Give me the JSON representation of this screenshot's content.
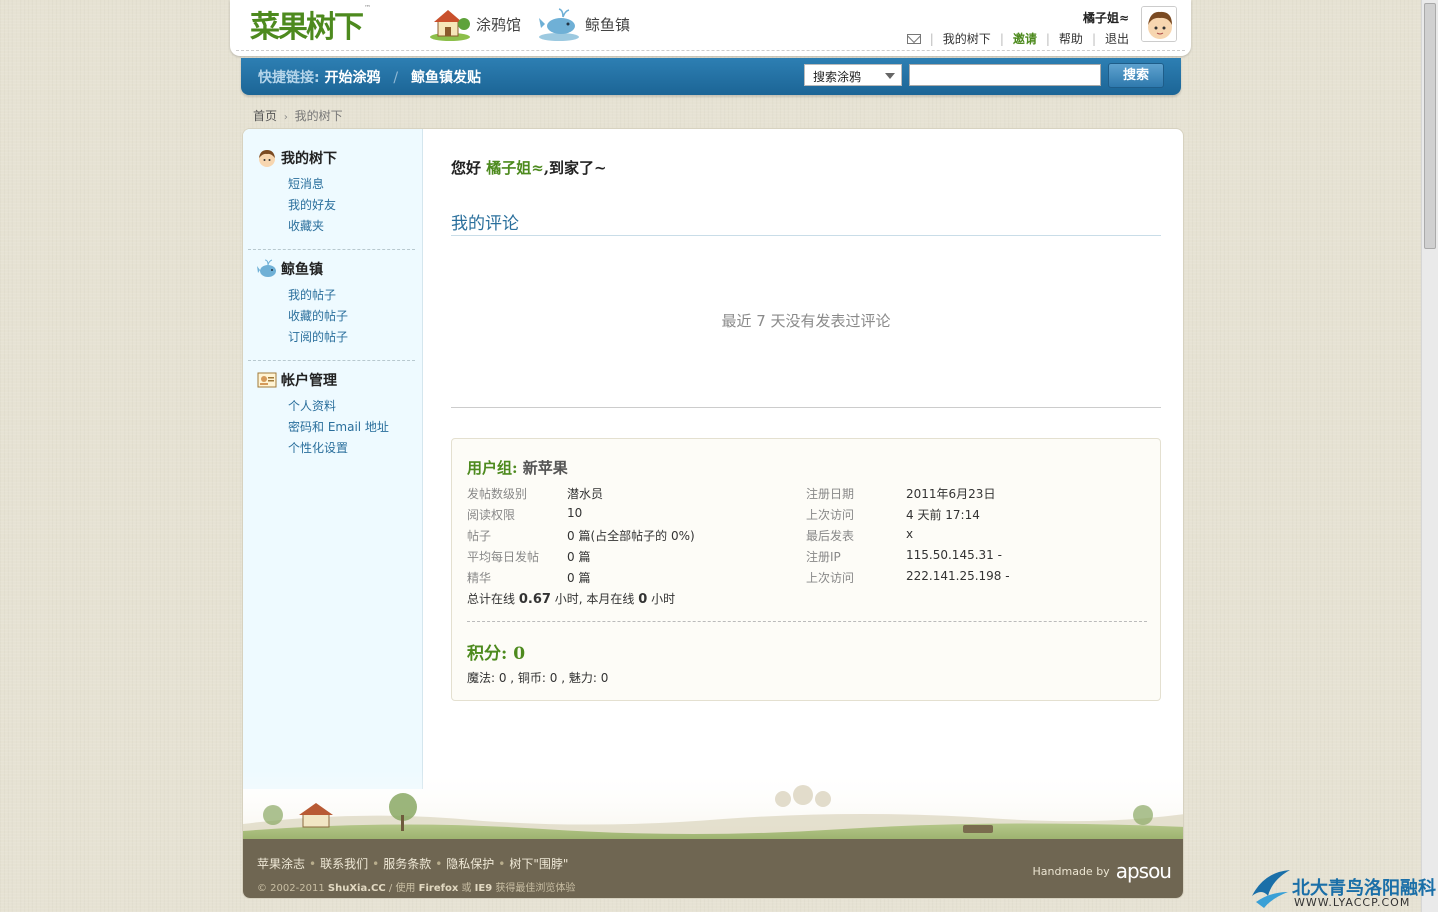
{
  "header": {
    "logo": "菜果树下",
    "logo_tm": "™",
    "nav": [
      {
        "label": "涂鸦馆"
      },
      {
        "label": "鲸鱼镇"
      }
    ],
    "username": "橘子姐≈",
    "links": {
      "mytree": "我的树下",
      "invite": "邀请",
      "help": "帮助",
      "logout": "退出"
    },
    "sep": "|"
  },
  "quickbar": {
    "prefix": "快捷链接:",
    "link1": "开始涂鸦",
    "slash": "/",
    "link2": "鲸鱼镇发贴",
    "select_value": "搜索涂鸦",
    "search_value": "",
    "search_button": "搜索"
  },
  "breadcrumb": {
    "home": "首页",
    "arrow": "›",
    "current": "我的树下"
  },
  "sidebar": {
    "sections": [
      {
        "title": "我的树下",
        "items": [
          "短消息",
          "我的好友",
          "收藏夹"
        ]
      },
      {
        "title": "鲸鱼镇",
        "items": [
          "我的帖子",
          "收藏的帖子",
          "订阅的帖子"
        ]
      },
      {
        "title": "帐户管理",
        "items": [
          "个人资料",
          "密码和 Email 地址",
          "个性化设置"
        ]
      }
    ]
  },
  "main": {
    "greeting_prefix": "您好",
    "greeting_name": "橘子姐≈",
    "greeting_suffix": ",到家了~",
    "section_title": "我的评论",
    "empty_message": "最近 7 天没有发表过评论",
    "usergroup_label": "用户组:",
    "usergroup_value": "新苹果",
    "stats_left": [
      {
        "k": "发帖数级别",
        "v": "潜水员"
      },
      {
        "k": "阅读权限",
        "v": "10"
      },
      {
        "k": "帖子",
        "v": "0 篇(占全部帖子的 0%)"
      },
      {
        "k": "平均每日发帖",
        "v": "0 篇"
      },
      {
        "k": "精华",
        "v": "0 篇"
      }
    ],
    "stats_right": [
      {
        "k": "注册日期",
        "v": "2011年6月23日"
      },
      {
        "k": "上次访问",
        "v": "4 天前 17:14"
      },
      {
        "k": "最后发表",
        "v": "x"
      },
      {
        "k": "注册IP",
        "v": "115.50.145.31 -"
      },
      {
        "k": "上次访问",
        "v": "222.141.25.198 -"
      }
    ],
    "online_a": "总计在线",
    "online_hours": "0.67",
    "online_b": "小时, 本月在线",
    "online_month": "0",
    "online_c": "小时",
    "score_label": "积分: 0",
    "coins": "魔法: 0 , 铜币: 0 , 魅力: 0"
  },
  "footer": {
    "links": [
      "苹果涂志",
      "联系我们",
      "服务条款",
      "隐私保护",
      "树下\"围脖\""
    ],
    "dot": "•",
    "copy_a": "© 2002-2011",
    "copy_site": "ShuXia.CC",
    "copy_sep": "/",
    "copy_b": "使用",
    "copy_ff": "Firefox",
    "copy_or": "或",
    "copy_ie": "IE9",
    "copy_c": "获得最佳浏览体验",
    "handmade": "Handmade by",
    "brand": "apsou"
  },
  "watermark": {
    "cn": "北大青鸟洛阳融科",
    "url": "WWW.LYACCP.COM"
  },
  "colors": {
    "brand_green": "#4d8a1e",
    "link_blue": "#2a6f9c",
    "bar_blue": "#1c6596"
  }
}
